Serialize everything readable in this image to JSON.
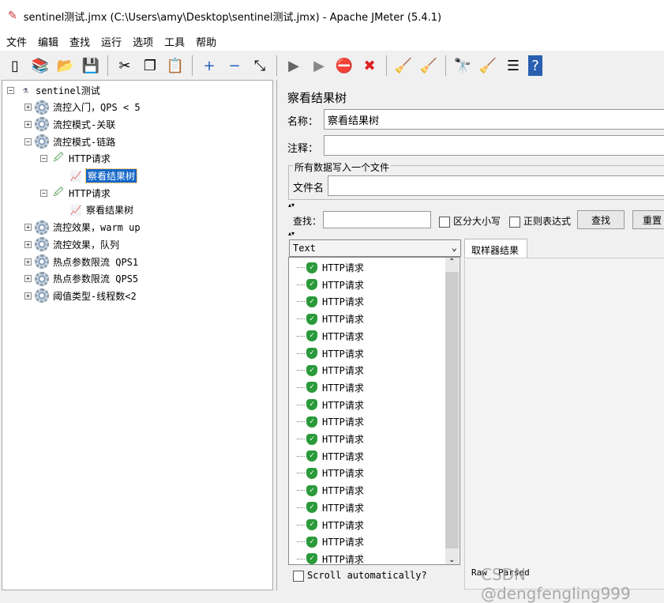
{
  "window": {
    "title": "sentinel测试.jmx (C:\\Users\\amy\\Desktop\\sentinel测试.jmx) - Apache JMeter (5.4.1)"
  },
  "menu": [
    "文件",
    "编辑",
    "查找",
    "运行",
    "选项",
    "工具",
    "帮助"
  ],
  "toolbar": [
    "new-icon",
    "templates-icon",
    "open-icon",
    "save-icon",
    "cut-icon",
    "copy-icon",
    "paste-icon",
    "expand-icon",
    "collapse-icon",
    "toggle-icon",
    "start-icon",
    "start-no-pause-icon",
    "stop-icon",
    "shutdown-icon",
    "clear-icon",
    "clear-all-icon",
    "search-icon",
    "reset-search-icon",
    "function-helper-icon",
    "help-icon"
  ],
  "tree": {
    "root": "sentinel测试",
    "items": [
      "流控入门，QPS < 5",
      "流控模式-关联",
      "流控模式-链路",
      "HTTP请求",
      "察看结果树",
      "HTTP请求",
      "察看结果树",
      "流控效果，warm up",
      "流控效果，队列",
      "热点参数限流 QPS1",
      "热点参数限流 QPS5",
      "阈值类型-线程数<2"
    ]
  },
  "panel": {
    "title": "察看结果树",
    "name_label": "名称：",
    "name_value": "察看结果树",
    "comment_label": "注释：",
    "comment_value": "",
    "file_group": "所有数据写入一个文件",
    "file_label": "文件名",
    "file_value": "",
    "search_label": "查找：",
    "search_value": "",
    "case_label": "区分大小写",
    "regex_label": "正则表达式",
    "find_button": "查找",
    "reset_button": "重置",
    "renderer": "Text",
    "results": [
      "HTTP请求",
      "HTTP请求",
      "HTTP请求",
      "HTTP请求",
      "HTTP请求",
      "HTTP请求",
      "HTTP请求",
      "HTTP请求",
      "HTTP请求",
      "HTTP请求",
      "HTTP请求",
      "HTTP请求",
      "HTTP请求",
      "HTTP请求",
      "HTTP请求",
      "HTTP请求",
      "HTTP请求",
      "HTTP请求"
    ],
    "scroll_label": "Scroll automatically?",
    "tab_sampler": "取样器结果",
    "raw_tab": "Raw",
    "parsed_tab": "Parsed"
  },
  "watermark": "CSDN @dengfengling999"
}
